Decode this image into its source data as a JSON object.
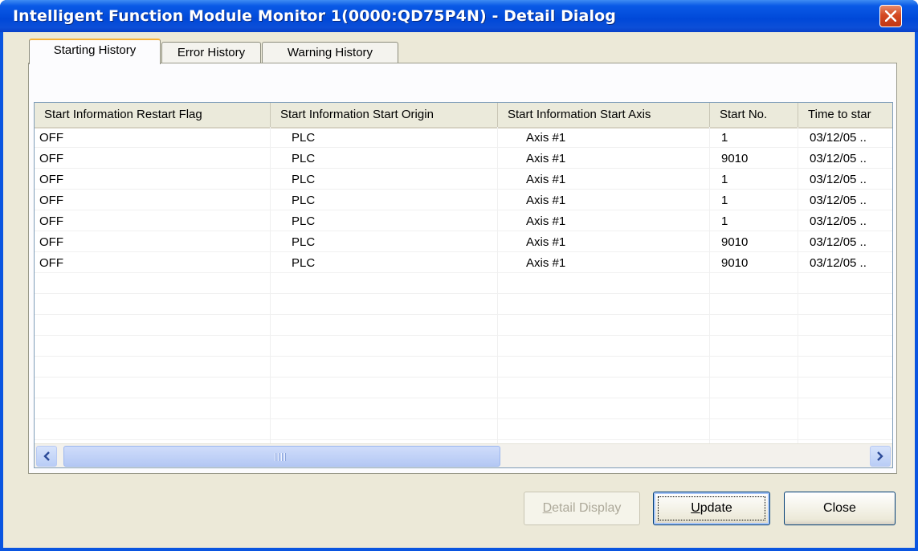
{
  "window": {
    "title": "Intelligent Function Module Monitor 1(0000:QD75P4N) - Detail Dialog"
  },
  "tabs": [
    {
      "label": "Starting History",
      "active": true
    },
    {
      "label": "Error History",
      "active": false
    },
    {
      "label": "Warning History",
      "active": false
    }
  ],
  "table": {
    "columns": [
      "Start Information Restart Flag",
      "Start Information Start Origin",
      "Start Information Start Axis",
      "Start No.",
      "Time to star"
    ],
    "rows": [
      [
        "OFF",
        "PLC",
        "Axis #1",
        "1",
        "03/12/05 .."
      ],
      [
        "OFF",
        "PLC",
        "Axis #1",
        "9010",
        "03/12/05 .."
      ],
      [
        "OFF",
        "PLC",
        "Axis #1",
        "1",
        "03/12/05 .."
      ],
      [
        "OFF",
        "PLC",
        "Axis #1",
        "1",
        "03/12/05 .."
      ],
      [
        "OFF",
        "PLC",
        "Axis #1",
        "1",
        "03/12/05 .."
      ],
      [
        "OFF",
        "PLC",
        "Axis #1",
        "9010",
        "03/12/05 .."
      ],
      [
        "OFF",
        "PLC",
        "Axis #1",
        "9010",
        "03/12/05 .."
      ]
    ]
  },
  "buttons": {
    "detail_display": {
      "label": "Detail Display",
      "mnemonic": "D",
      "rest": "etail Display"
    },
    "update": {
      "label": "Update",
      "mnemonic": "U",
      "rest": "pdate"
    },
    "close": {
      "label": "Close"
    }
  },
  "colors": {
    "titlebar": "#0a55e0",
    "dialog_face": "#ece9d8",
    "close_button": "#d44a23",
    "tab_active_accent": "#f7b237"
  },
  "icons": {
    "close": "close-icon",
    "scroll_left": "arrow-left-icon",
    "scroll_right": "arrow-right-icon"
  }
}
